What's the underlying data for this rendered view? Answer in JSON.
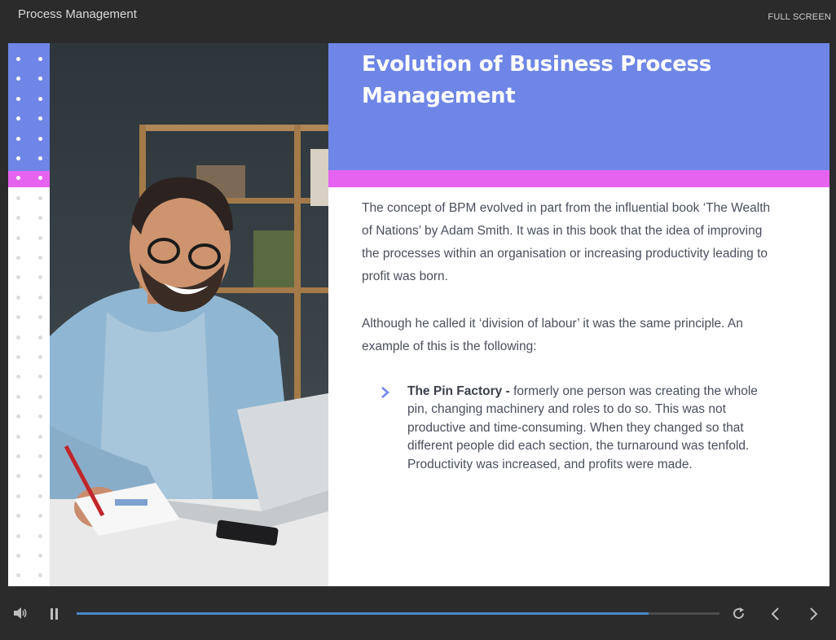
{
  "app": {
    "title": "Process Management",
    "fullscreen_label": "FULL SCREEN"
  },
  "slide": {
    "title": "Evolution of Business Process Management",
    "paragraph1": "The concept of BPM evolved in part from the influential book ‘The Wealth of Nations’ by Adam Smith. It was in this book that the idea of improving the processes within an organisation or increasing productivity leading to profit was born.",
    "paragraph2": "Although he called it ‘division of labour’ it was the same principle. An example of this is the following:",
    "bullet": {
      "bold": "The Pin Factory - ",
      "text": "formerly one person was creating the whole pin, changing machinery and roles to do so. This was not productive and time-consuming. When they changed so that different people did each section, the turnaround was tenfold. Productivity was increased, and profits were made."
    },
    "image": "smiling man writing at desk with laptop",
    "colors": {
      "accent_blue": "#6f86e6",
      "accent_pink": "#e563ef",
      "text": "#4a4f5e"
    }
  },
  "player": {
    "progress_fraction": 0.89,
    "icons": [
      "volume-icon",
      "pause-icon",
      "replay-icon",
      "prev-icon",
      "next-icon"
    ]
  }
}
